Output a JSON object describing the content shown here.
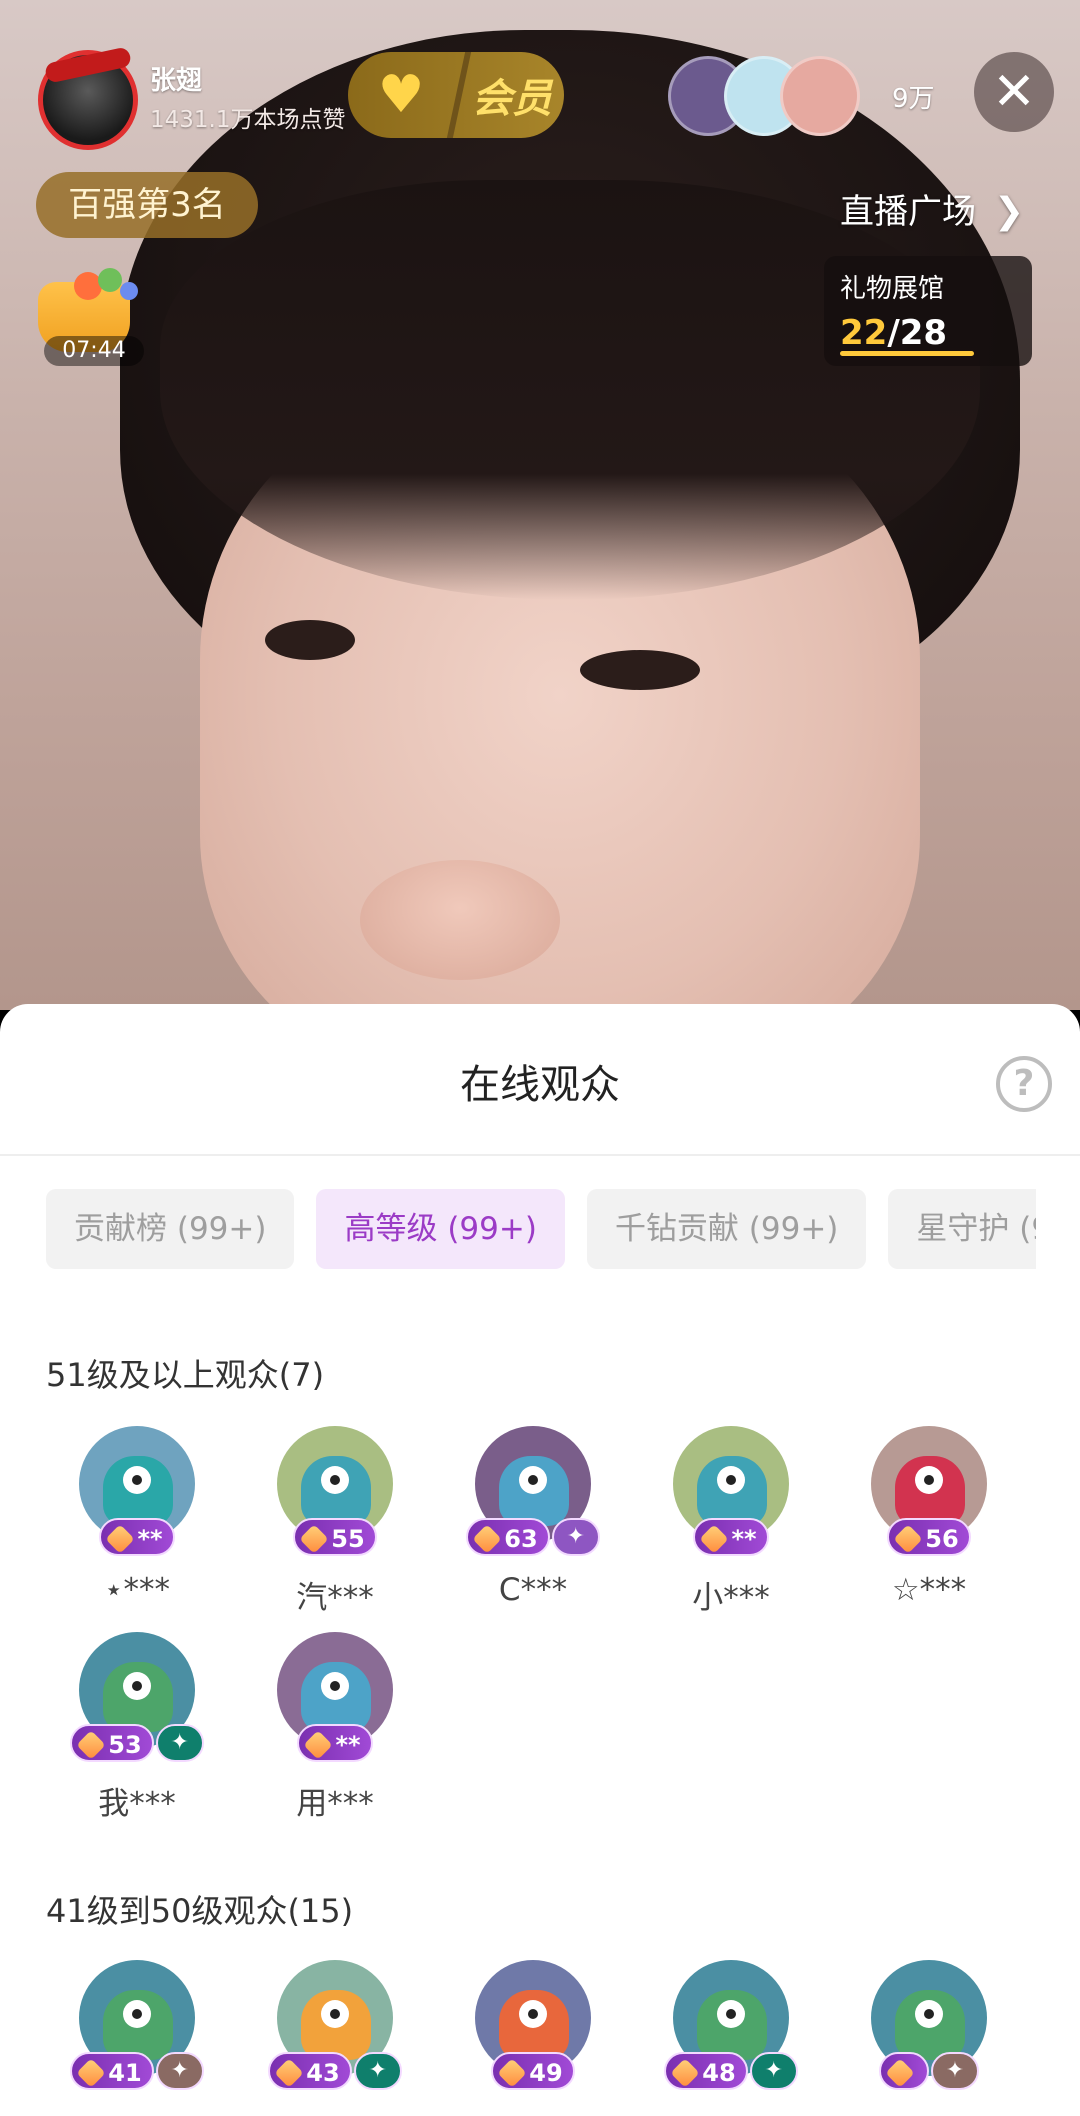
{
  "host": {
    "name": "张翅",
    "likes": "1431.1万本场点赞"
  },
  "vip": {
    "label": "会员"
  },
  "viewers_online": "9万",
  "rank_badge": "百强第3名",
  "plaza": {
    "label": "直播广场"
  },
  "timer": "07:44",
  "gift_hall": {
    "title": "礼物展馆",
    "current": "22",
    "separator": "/",
    "total": "28",
    "progress": 0.786
  },
  "sheet": {
    "title": "在线观众",
    "help": "?",
    "tabs": [
      {
        "label": "贡献榜 (99+)",
        "active": false
      },
      {
        "label": "高等级 (99+)",
        "active": true
      },
      {
        "label": "千钻贡献 (99+)",
        "active": false
      },
      {
        "label": "星守护 (9",
        "active": false
      }
    ],
    "sections": [
      {
        "title": "51级及以上观众(7)",
        "viewers": [
          {
            "name": "⋆***",
            "level": "**",
            "avatar_color": "#6fa3bf",
            "monster_color": "#2aa7a8",
            "extra": ""
          },
          {
            "name": "汽***",
            "level": "55",
            "avatar_color": "#a9be82",
            "monster_color": "#3fa3b5",
            "extra": ""
          },
          {
            "name": "C***",
            "level": "63",
            "avatar_color": "#7a5e8a",
            "monster_color": "#4da3c8",
            "extra": "✦"
          },
          {
            "name": "小***",
            "level": "**",
            "avatar_color": "#a9be82",
            "monster_color": "#3fa3b5",
            "extra": ""
          },
          {
            "name": "☆***",
            "level": "56",
            "avatar_color": "#b79a94",
            "monster_color": "#d2334f",
            "extra": ""
          },
          {
            "name": "我***",
            "level": "53",
            "avatar_color": "#4b8fa3",
            "monster_color": "#4da56a",
            "extra": "✦"
          },
          {
            "name": "用***",
            "level": "**",
            "avatar_color": "#8a6c95",
            "monster_color": "#4da3c8",
            "extra": ""
          }
        ]
      },
      {
        "title": "41级到50级观众(15)",
        "viewers": [
          {
            "name": "",
            "level": "41",
            "avatar_color": "#4b8fa3",
            "monster_color": "#4da56a",
            "extra": "✦"
          },
          {
            "name": "",
            "level": "43",
            "avatar_color": "#88b4a3",
            "monster_color": "#f2a23b",
            "extra": "✦"
          },
          {
            "name": "",
            "level": "49",
            "avatar_color": "#6f79a8",
            "monster_color": "#e8673c",
            "extra": ""
          },
          {
            "name": "",
            "level": "48",
            "avatar_color": "#4b8fa3",
            "monster_color": "#4da56a",
            "extra": "✦"
          },
          {
            "name": "",
            "level": "",
            "avatar_color": "#4b8fa3",
            "monster_color": "#4da56a",
            "extra": "✦"
          }
        ]
      }
    ]
  },
  "colors": {
    "accent_purple": "#9b3bc6",
    "active_tab_bg": "#f4e7fb",
    "gold": "#ffc93b",
    "close_red": "#e03030"
  },
  "icons": {
    "close": "close-icon",
    "chevron": "chevron-right-icon",
    "help": "help-icon",
    "heart": "vip-heart-icon"
  }
}
